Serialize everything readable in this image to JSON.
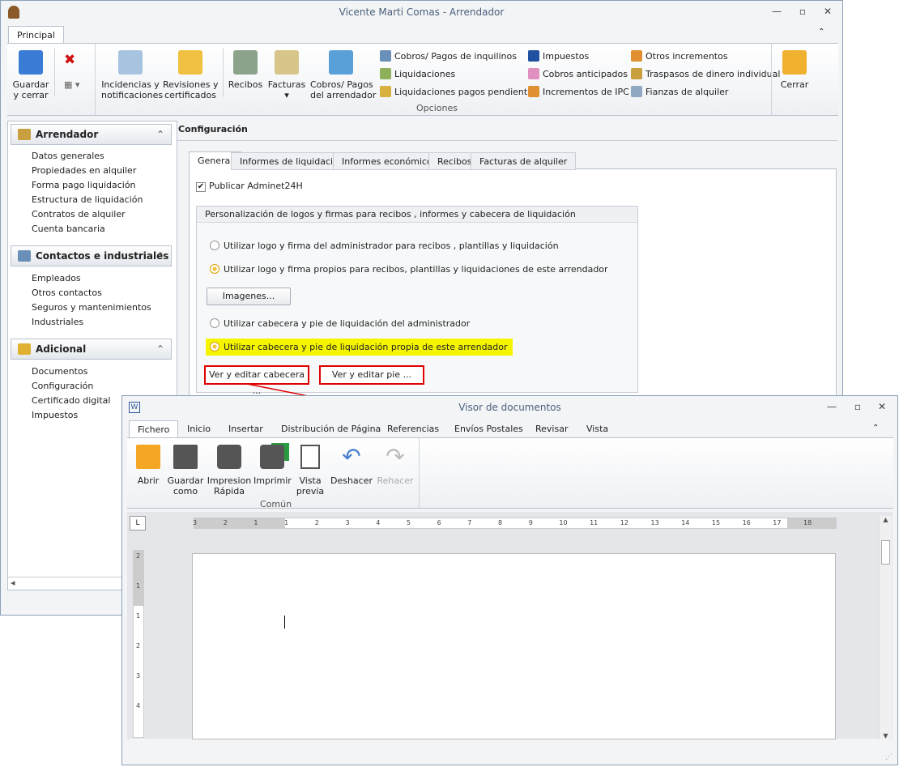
{
  "main_window": {
    "title": "Vicente Marti Comas - Arrendador",
    "controls": [
      "minimize",
      "maximize",
      "close"
    ],
    "ribbon_tab": "Principal",
    "ribbon": {
      "guardar": "Guardar\ny cerrar",
      "incidencias": "Incidencias y\nnotificaciones",
      "revisiones": "Revisiones y\ncertificados",
      "recibos": "Recibos",
      "facturas": "Facturas",
      "cobros_arr": "Cobros/ Pagos\ndel arrendador",
      "small_col1": [
        "Cobros/ Pagos de inquilinos",
        "Liquidaciones",
        "Liquidaciones pagos pendientes"
      ],
      "small_col2": [
        "Impuestos",
        "Cobros anticipados",
        "Incrementos de IPC"
      ],
      "small_col3": [
        "Otros incrementos",
        "Traspasos de dinero individual",
        "Fianzas de alquiler"
      ],
      "group_label": "Opciones",
      "cerrar": "Cerrar"
    },
    "sidebar": {
      "groups": [
        {
          "title": "Arrendador",
          "items": [
            "Datos generales",
            "Propiedades en alquiler",
            "Forma pago liquidación",
            "Estructura de liquidación",
            "Contratos de alquiler",
            "Cuenta bancaria"
          ]
        },
        {
          "title": "Contactos e industriales",
          "items": [
            "Empleados",
            "Otros contactos",
            "Seguros y mantenimientos",
            "Industriales"
          ]
        },
        {
          "title": "Adicional",
          "items": [
            "Documentos",
            "Configuración",
            "Certificado digital",
            "Impuestos"
          ]
        }
      ]
    },
    "content": {
      "header": "Configuración",
      "tabs": [
        "General",
        "Informes de liquidación",
        "Informes económicos",
        "Recibos",
        "Facturas de alquiler"
      ],
      "publicar": "Publicar Adminet24H",
      "publicar_checked": true,
      "group_title": "Personalización de logos y firmas para recibos , informes y cabecera de liquidación",
      "radio1": "Utilizar logo y firma del administrador para recibos , plantillas y liquidación",
      "radio2": "Utilizar logo y firma propios para recibos, plantillas y liquidaciones de este arrendador",
      "imagenes": "Imagenes...",
      "radio3": "Utilizar cabecera y pie de liquidación del administrador",
      "radio4": "Utilizar cabecera y pie de liquidación propia de este arrendador",
      "ver_cabecera": "Ver y editar cabecera ...",
      "ver_pie": "Ver y editar pie ..."
    }
  },
  "doc_window": {
    "title": "Visor de documentos",
    "tabs": [
      "Fichero",
      "Inicio",
      "Insertar",
      "Distribución de Página",
      "Referencias",
      "Envíos Postales",
      "Revisar",
      "Vista"
    ],
    "buttons": [
      "Abrir",
      "Guardar\ncomo",
      "Impresion\nRápida",
      "Imprimir",
      "Vista\nprevia",
      "Deshacer",
      "Rehacer"
    ],
    "group_label": "Común",
    "ruler": [
      "3",
      "2",
      "1",
      "1",
      "2",
      "3",
      "4",
      "5",
      "6",
      "7",
      "8",
      "9",
      "10",
      "11",
      "12",
      "13",
      "14",
      "15",
      "16",
      "17",
      "18"
    ],
    "vruler": [
      "2",
      "1",
      "1",
      "2",
      "3",
      "4"
    ]
  },
  "colors": {
    "highlight": "#f5f500",
    "annotation": "#e00000"
  }
}
